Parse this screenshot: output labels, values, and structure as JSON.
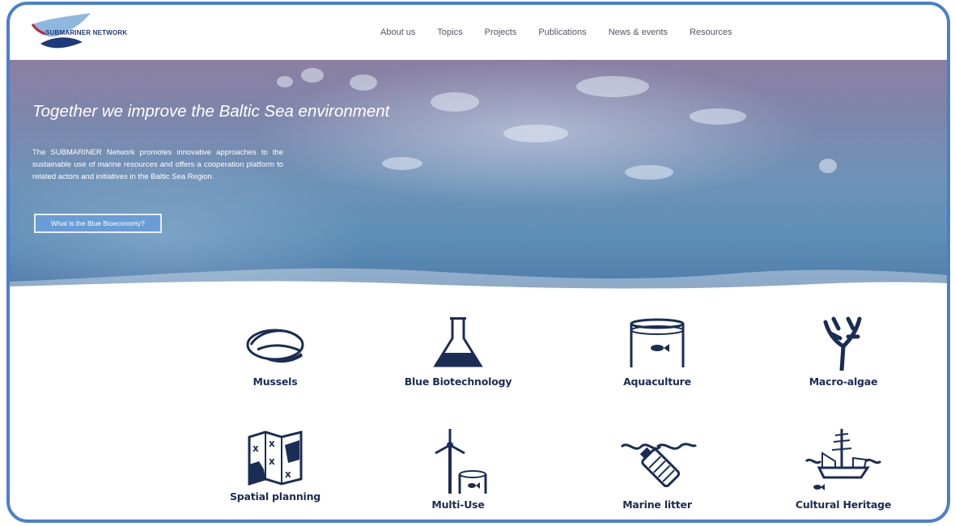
{
  "brand": {
    "logo_text": "SUBMARINER NETWORK",
    "accent": "#1f3a7a",
    "frame": "#4a7fd0"
  },
  "nav": {
    "items": [
      "About us",
      "Topics",
      "Projects",
      "Publications",
      "News & events",
      "Resources"
    ]
  },
  "hero": {
    "title": "Together we improve the Baltic Sea environment",
    "text": "The SUBMARINER Network promotes innovative approaches to the sustainable use of marine resources and offers a cooperation platform to related actors and initiatives in the Baltic Sea Region.",
    "button": "What is the Blue Bioeconomy?"
  },
  "topics": [
    {
      "label": "Mussels",
      "icon": "mussel-icon"
    },
    {
      "label": "Blue Biotechnology",
      "icon": "flask-icon"
    },
    {
      "label": "Aquaculture",
      "icon": "fish-cage-icon"
    },
    {
      "label": "Macro-algae",
      "icon": "seaweed-icon"
    },
    {
      "label": "Spatial planning",
      "icon": "map-icon"
    },
    {
      "label": "Multi-Use",
      "icon": "wind-turbine-icon"
    },
    {
      "label": "Marine litter",
      "icon": "bottle-icon"
    },
    {
      "label": "Cultural Heritage",
      "icon": "ship-icon"
    }
  ]
}
